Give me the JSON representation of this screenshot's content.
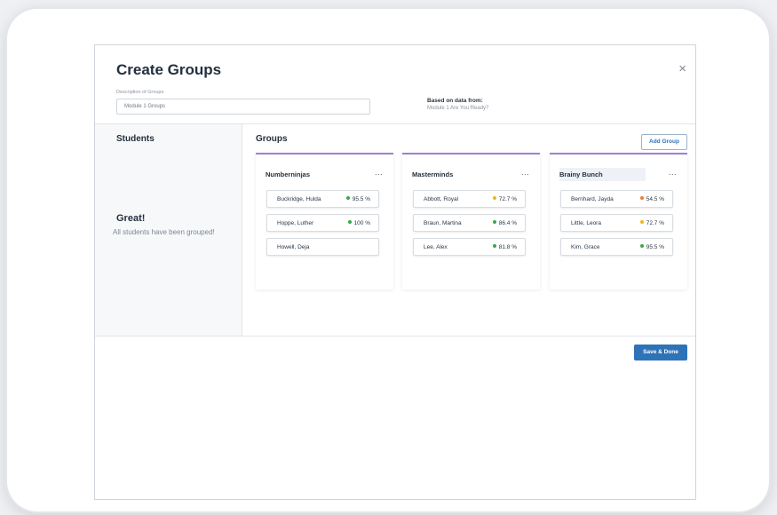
{
  "dialog": {
    "title": "Create Groups",
    "close_glyph": "×",
    "description_label": "Description of Groups",
    "description_value": "Module 1 Groups",
    "based_on_label": "Based on data from:",
    "based_on_value": "Module 1 Are You Ready?"
  },
  "students_panel": {
    "title": "Students",
    "status_title": "Great!",
    "status_text": "All students have been grouped!"
  },
  "groups_panel": {
    "title": "Groups",
    "add_group_label": "Add Group",
    "more_glyph": "...",
    "groups": [
      {
        "name": "Numberninjas",
        "students": [
          {
            "name": "Buckridge, Hulda",
            "score": "95.5 %",
            "status": "green"
          },
          {
            "name": "Hoppe, Luther",
            "score": "100 %",
            "status": "green"
          },
          {
            "name": "Howell, Deja",
            "score": "",
            "status": "none"
          }
        ]
      },
      {
        "name": "Masterminds",
        "students": [
          {
            "name": "Abbott, Royal",
            "score": "72.7 %",
            "status": "yellow"
          },
          {
            "name": "Braun, Martina",
            "score": "86.4 %",
            "status": "green"
          },
          {
            "name": "Lee, Alex",
            "score": "81.8 %",
            "status": "green"
          }
        ]
      },
      {
        "name": "Brainy Bunch",
        "students": [
          {
            "name": "Bernhard, Jayda",
            "score": "54.5 %",
            "status": "orange"
          },
          {
            "name": "Little, Leora",
            "score": "72.7 %",
            "status": "yellow"
          },
          {
            "name": "Kim, Grace",
            "score": "95.5 %",
            "status": "green"
          }
        ]
      }
    ]
  },
  "footer": {
    "save_label": "Save & Done"
  },
  "colors": {
    "accent": "#2e73b8",
    "group_border": "#a27fd6",
    "status_green": "#3aa845",
    "status_yellow": "#f2b51d",
    "status_orange": "#f07c2c"
  }
}
